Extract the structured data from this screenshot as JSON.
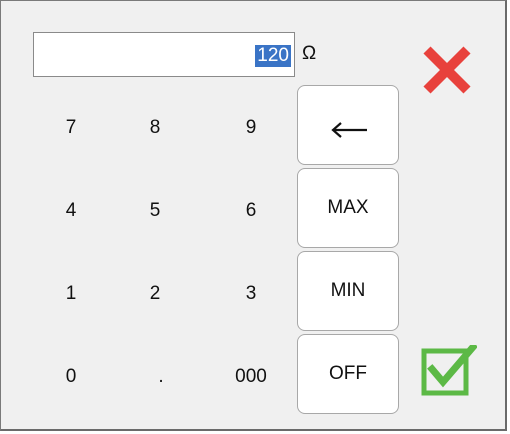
{
  "entry": {
    "value": "120",
    "unit": "Ω"
  },
  "keypad": {
    "keys": [
      "7",
      "8",
      "9",
      "4",
      "5",
      "6",
      "1",
      "2",
      "3",
      "0",
      ".",
      "000"
    ]
  },
  "side_keys": {
    "max": "MAX",
    "min": "MIN",
    "off": "OFF"
  },
  "icons": {
    "backspace": "left-arrow-icon",
    "cancel": "close-icon",
    "confirm": "checkbox-check-icon"
  },
  "colors": {
    "cancel": "#e8413c",
    "confirm": "#5cb946",
    "selection": "#3a74c6",
    "panel_background": "#f0f0f0"
  }
}
